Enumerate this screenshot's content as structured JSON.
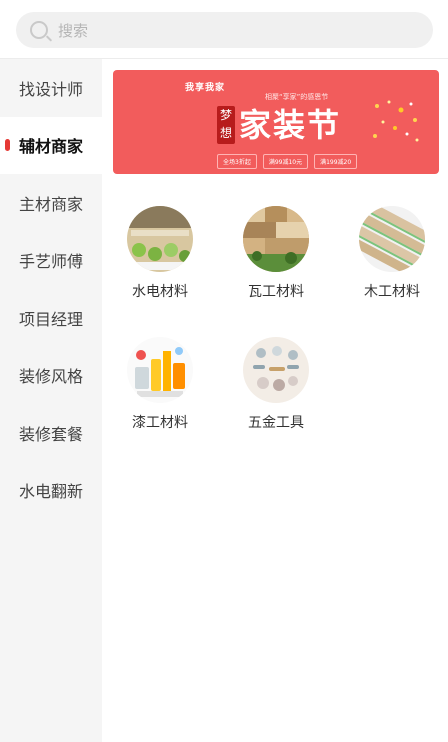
{
  "search": {
    "placeholder": "搜索"
  },
  "sidebar": {
    "items": [
      {
        "label": "找设计师",
        "active": false
      },
      {
        "label": "辅材商家",
        "active": true
      },
      {
        "label": "主材商家",
        "active": false
      },
      {
        "label": "手艺师傅",
        "active": false
      },
      {
        "label": "项目经理",
        "active": false
      },
      {
        "label": "装修风格",
        "active": false
      },
      {
        "label": "装修套餐",
        "active": false
      },
      {
        "label": "水电翻新",
        "active": false
      }
    ]
  },
  "banner": {
    "logo": "我享我家",
    "subtitle": "相聚“享家”的感恩节",
    "badge": "梦想",
    "title": "家装节",
    "coupons": [
      "全场3折起",
      "满99减10元",
      "满199减20"
    ],
    "color": "#f25c5c"
  },
  "categories": [
    {
      "label": "水电材料",
      "icon": "plumbing-materials-photo"
    },
    {
      "label": "瓦工材料",
      "icon": "tiling-materials-photo"
    },
    {
      "label": "木工材料",
      "icon": "carpentry-materials-photo"
    },
    {
      "label": "漆工材料",
      "icon": "paint-materials-photo"
    },
    {
      "label": "五金工具",
      "icon": "hardware-tools-photo"
    }
  ],
  "accent_color": "#e53935"
}
